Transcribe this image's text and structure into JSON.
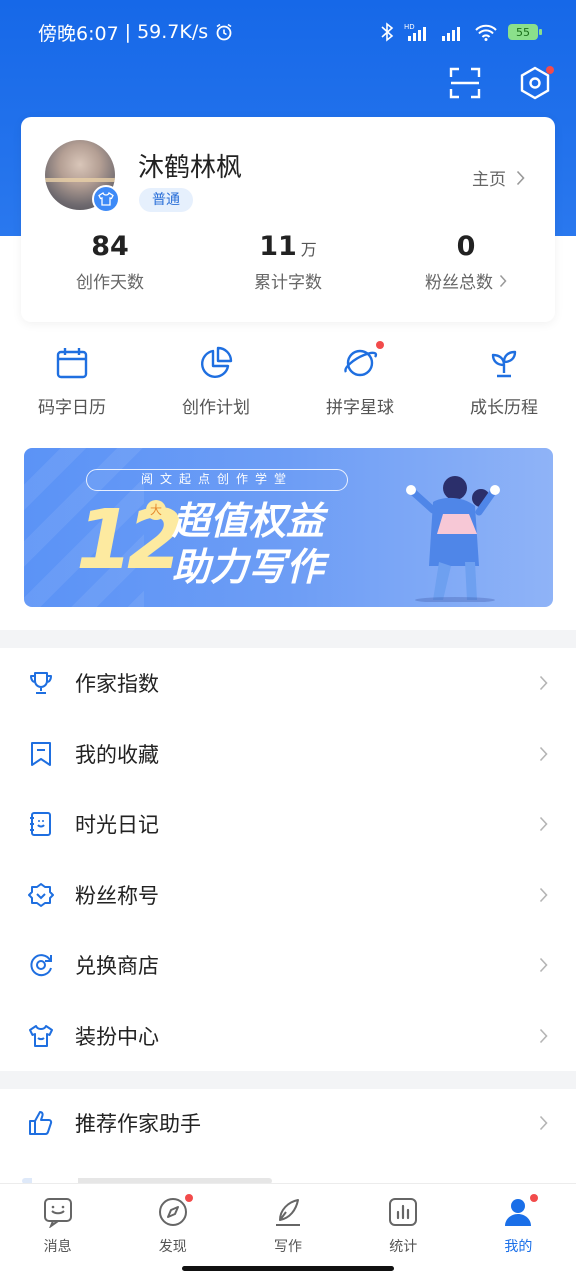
{
  "status_bar": {
    "time": "傍晚6:07",
    "speed": "59.7K/s",
    "battery": "55"
  },
  "profile": {
    "name": "沐鹤林枫",
    "level": "普通",
    "homepage": "主页"
  },
  "stats": [
    {
      "value": "84",
      "unit": "",
      "label": "创作天数"
    },
    {
      "value": "11",
      "unit": "万",
      "label": "累计字数"
    },
    {
      "value": "0",
      "unit": "",
      "label": "粉丝总数"
    }
  ],
  "tools": [
    {
      "label": "码字日历",
      "icon": "calendar-icon"
    },
    {
      "label": "创作计划",
      "icon": "pie-chart-icon"
    },
    {
      "label": "拼字星球",
      "icon": "planet-icon"
    },
    {
      "label": "成长历程",
      "icon": "sprout-icon"
    }
  ],
  "banner": {
    "subtitle": "阅文起点创作学堂",
    "number": "12",
    "number_badge": "大",
    "line1": "超值权益",
    "line2": "助力写作"
  },
  "menu_group1": [
    {
      "label": "作家指数",
      "icon": "trophy-icon"
    },
    {
      "label": "我的收藏",
      "icon": "bookmark-icon"
    },
    {
      "label": "时光日记",
      "icon": "diary-icon"
    },
    {
      "label": "粉丝称号",
      "icon": "badge-icon"
    },
    {
      "label": "兑换商店",
      "icon": "exchange-icon"
    },
    {
      "label": "装扮中心",
      "icon": "tshirt-icon"
    }
  ],
  "menu_group2": [
    {
      "label": "推荐作家助手",
      "icon": "thumbs-up-icon"
    }
  ],
  "tabbar": [
    {
      "label": "消息",
      "icon": "message-icon",
      "active": false
    },
    {
      "label": "发现",
      "icon": "compass-icon",
      "active": false
    },
    {
      "label": "写作",
      "icon": "pen-icon",
      "active": false
    },
    {
      "label": "统计",
      "icon": "chart-icon",
      "active": false
    },
    {
      "label": "我的",
      "icon": "person-icon",
      "active": true
    }
  ],
  "colors": {
    "primary": "#1a6fe8",
    "header": "#1668e8",
    "notification_dot": "#f24b4b"
  }
}
